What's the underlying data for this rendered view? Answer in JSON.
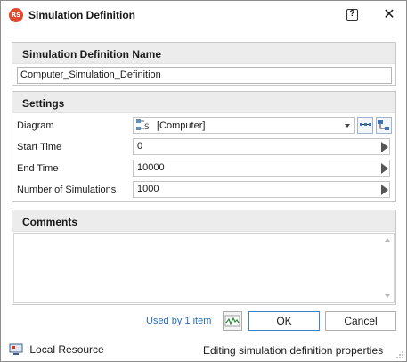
{
  "window": {
    "title": "Simulation Definition",
    "app_icon_text": "RS",
    "help_label": "?",
    "close_label": "✕"
  },
  "name_section": {
    "header": "Simulation Definition Name",
    "value": "Computer_Simulation_Definition"
  },
  "settings": {
    "header": "Settings",
    "diagram_label": "Diagram",
    "diagram_value": "[Computer]",
    "start_time_label": "Start Time",
    "start_time_value": "0",
    "end_time_label": "End Time",
    "end_time_value": "10000",
    "num_sims_label": "Number of Simulations",
    "num_sims_value": "1000"
  },
  "comments": {
    "header": "Comments",
    "value": ""
  },
  "footer": {
    "used_by": "Used by 1 item",
    "ok": "OK",
    "cancel": "Cancel"
  },
  "status": {
    "left": "Local Resource",
    "right": "Editing simulation definition properties"
  },
  "colors": {
    "app_icon": "#e04a32",
    "link": "#2a6ebb",
    "panel_header": "#ececec"
  }
}
